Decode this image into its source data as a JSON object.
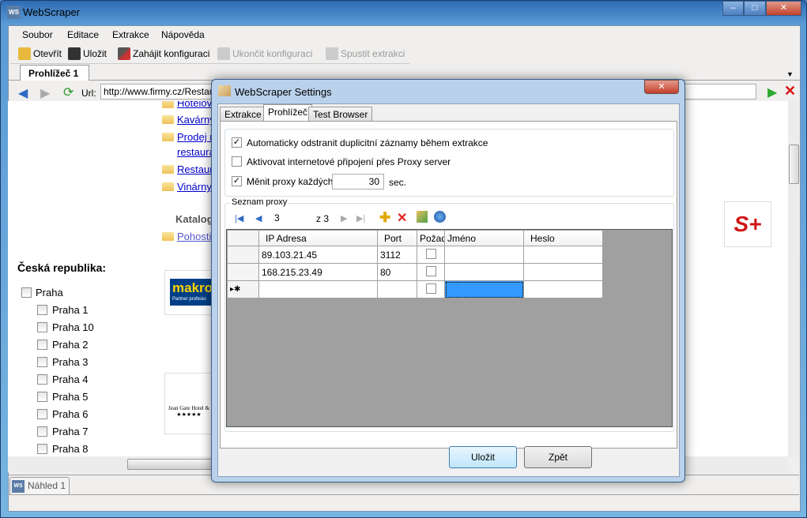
{
  "window": {
    "title": "WebScraper",
    "app_icon": "WS",
    "minimize": "–",
    "maximize": "□",
    "close": "✕"
  },
  "menu": [
    "Soubor",
    "Editace",
    "Extrakce",
    "Nápověda"
  ],
  "toolbar": {
    "open": "Otevřít",
    "save": "Uložit",
    "start_config": "Zahájit konfiguraci",
    "end_config": "Ukončit konfiguraci",
    "run_extraction": "Spustit extrakci"
  },
  "tabs": {
    "browser": "Prohlížeč 1",
    "preview": "Náhled 1"
  },
  "browser": {
    "url_label": "Url:",
    "url": "http://www.firmy.cz/Restaurace"
  },
  "page": {
    "links": [
      "Hotelov",
      "Kavárny",
      "Prodej r",
      "restaura",
      "Restaur",
      "Vinárny"
    ],
    "catalog_heading": "Katalog",
    "catalog_link": "Pohosti",
    "region_heading": "Česká republika:",
    "region_root": "Praha",
    "regions": [
      "Praha 1",
      "Praha 10",
      "Praha 2",
      "Praha 3",
      "Praha 4",
      "Praha 5",
      "Praha 6",
      "Praha 7",
      "Praha 8"
    ],
    "ad1": "makro",
    "ad1_sub": "Partner profesio",
    "ad2": "Jean Gate Hotel & ",
    "ad2_stars": "★★★★★",
    "logo": "S+"
  },
  "dialog": {
    "title": "WebScraper Settings",
    "close": "✕",
    "tabs": [
      "Extrakce",
      "Prohlížeč",
      "Test Browser"
    ],
    "options": {
      "dedupe": {
        "label": "Automaticky odstranit duplicitní záznamy během extrakce",
        "checked": true
      },
      "proxy": {
        "label": "Aktivovat internetové připojení přes Proxy server",
        "checked": false
      },
      "rotate": {
        "label": "Měnit proxy každých",
        "checked": true,
        "value": "30",
        "unit": "sec."
      }
    },
    "proxy_group": "Seznam proxy",
    "navigator": {
      "position": "3",
      "total": "z 3"
    },
    "grid": {
      "columns": [
        "IP Adresa",
        "Port",
        "Požad",
        "Jméno",
        "Heslo"
      ],
      "rows": [
        {
          "ip": "89.103.21.45",
          "port": "3112",
          "auth": false,
          "name": "",
          "password": ""
        },
        {
          "ip": "168.215.23.49",
          "port": "80",
          "auth": false,
          "name": "",
          "password": ""
        }
      ],
      "new_row_marker": "▸✱"
    },
    "ok": "Uložit",
    "back": "Zpět"
  }
}
